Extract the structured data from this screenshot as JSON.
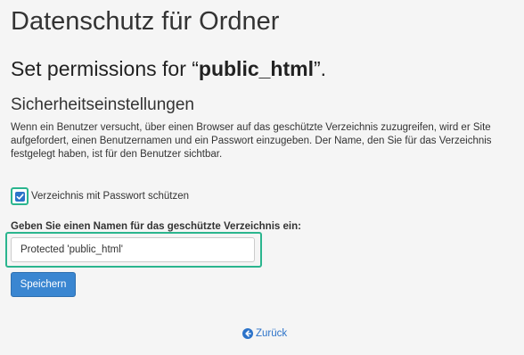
{
  "page": {
    "title": "Datenschutz für Ordner",
    "subtitle_prefix": "Set permissions for “",
    "subtitle_folder": "public_html",
    "subtitle_suffix": "”.",
    "section_heading": "Sicherheitseinstellungen",
    "description": "Wenn ein Benutzer versucht, über einen Browser auf das geschützte Verzeichnis zuzugreifen, wird er Site aufgefordert, einen Benutzernamen und ein Passwort einzugeben. Der Name, den Sie für das Verzeichnis festgelegt haben, ist für den Benutzer sichtbar."
  },
  "protect_checkbox": {
    "label": "Verzeichnis mit Passwort schützen",
    "checked": true
  },
  "directory_name_field": {
    "label": "Geben Sie einen Namen für das geschützte Verzeichnis ein:",
    "value": "Protected 'public_html'"
  },
  "actions": {
    "save_label": "Speichern",
    "back_label": "Zurück"
  },
  "colors": {
    "accent": "#3a86d1",
    "highlight": "#2bb58e",
    "link": "#2c73c9"
  }
}
